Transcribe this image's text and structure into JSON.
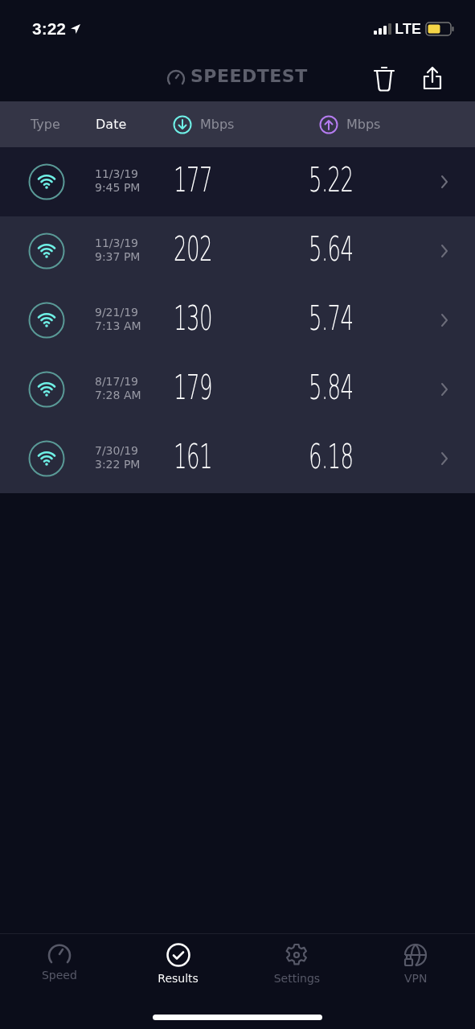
{
  "status_bar": {
    "time": "3:22",
    "network": "LTE"
  },
  "header": {
    "logo": "SPEEDTEST"
  },
  "columns": [
    {
      "kind": "text",
      "label": "Type",
      "selected": false
    },
    {
      "kind": "text",
      "label": "Date",
      "selected": true
    },
    {
      "kind": "download",
      "label": "Mbps",
      "selected": false
    },
    {
      "kind": "upload",
      "label": "Mbps",
      "selected": false
    }
  ],
  "results": [
    {
      "kind": "wifi",
      "date": "11/3/19",
      "time": "9:45 PM",
      "download": "177",
      "upload": "5.22",
      "selected": true
    },
    {
      "kind": "wifi",
      "date": "11/3/19",
      "time": "9:37 PM",
      "download": "202",
      "upload": "5.64",
      "selected": false
    },
    {
      "kind": "wifi",
      "date": "9/21/19",
      "time": "7:13 AM",
      "download": "130",
      "upload": "5.74",
      "selected": false
    },
    {
      "kind": "wifi",
      "date": "8/17/19",
      "time": "7:28 AM",
      "download": "179",
      "upload": "5.84",
      "selected": false
    },
    {
      "kind": "wifi",
      "date": "7/30/19",
      "time": "3:22 PM",
      "download": "161",
      "upload": "6.18",
      "selected": false
    }
  ],
  "tabs": [
    {
      "kind": "speed",
      "label": "Speed",
      "selected": false
    },
    {
      "kind": "results",
      "label": "Results",
      "selected": true
    },
    {
      "kind": "settings",
      "label": "Settings",
      "selected": false
    },
    {
      "kind": "vpn",
      "label": "VPN",
      "selected": false
    }
  ]
}
